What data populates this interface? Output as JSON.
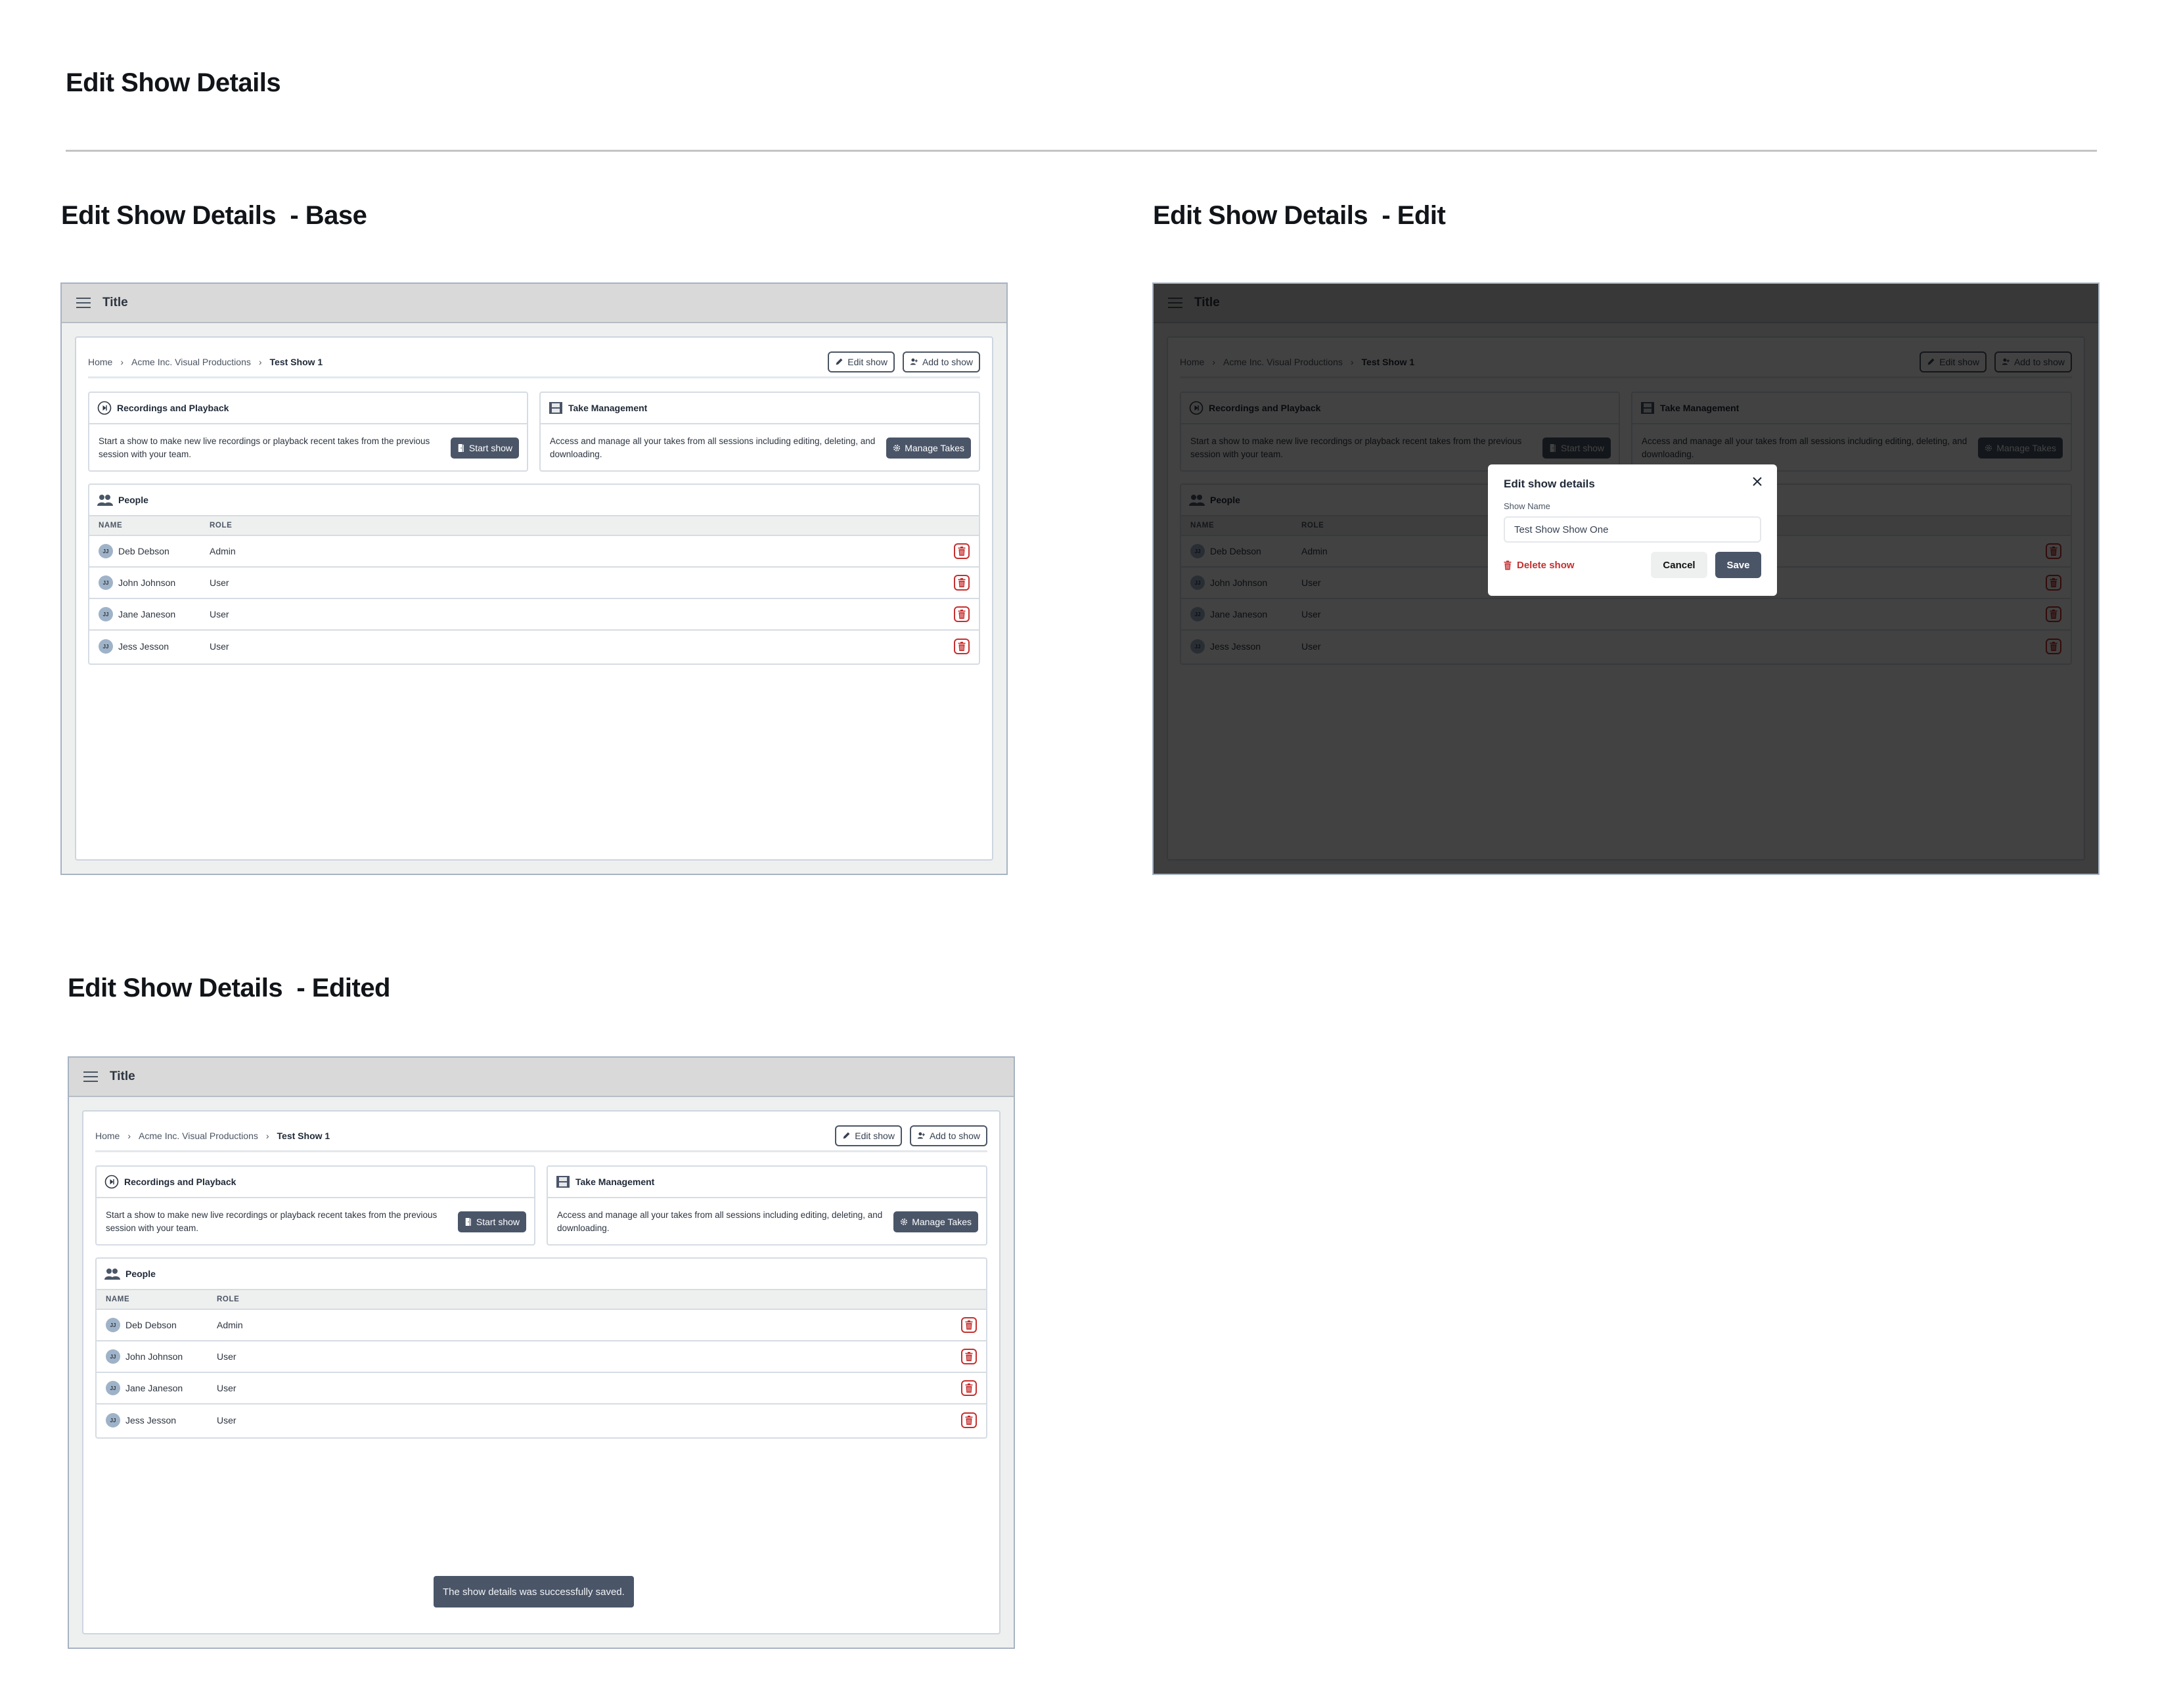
{
  "page": {
    "title": "Edit Show Details",
    "sections": {
      "base": "Edit Show Details  - Base",
      "edit": "Edit Show Details  - Edit",
      "edited": "Edit Show Details  - Edited"
    }
  },
  "app": {
    "topbar_title": "Title",
    "menu_icon": "hamburger-menu-icon",
    "breadcrumb": [
      "Home",
      "Acme Inc. Visual Productions",
      "Test Show 1"
    ],
    "breadcrumb_separator_icon": "chevron-right-icon",
    "actions": {
      "edit_show": "Edit show",
      "add_to_show": "Add to show"
    },
    "recordings": {
      "title": "Recordings and Playback",
      "icon": "play-circle-icon",
      "text": "Start a show to make new live recordings or playback recent takes from the previous session with your team.",
      "button": "Start show",
      "button_icon": "door-icon"
    },
    "takes": {
      "title": "Take Management",
      "icon": "film-icon",
      "text": "Access and manage all your takes from all sessions including editing, deleting, and downloading.",
      "button": "Manage Takes",
      "button_icon": "gear-icon"
    },
    "people": {
      "title": "People",
      "icon": "users-icon",
      "columns": [
        "NAME",
        "ROLE"
      ],
      "rows": [
        {
          "initials": "JJ",
          "name": "Deb Debson",
          "role": "Admin"
        },
        {
          "initials": "JJ",
          "name": "John Johnson",
          "role": "User"
        },
        {
          "initials": "JJ",
          "name": "Jane Janeson",
          "role": "User"
        },
        {
          "initials": "JJ",
          "name": "Jess Jesson",
          "role": "User"
        }
      ],
      "row_action_icon": "trash-icon"
    }
  },
  "modal": {
    "title": "Edit show details",
    "field_label": "Show Name",
    "field_value": "Test Show Show One",
    "delete_label": "Delete show",
    "cancel_label": "Cancel",
    "save_label": "Save"
  },
  "toast": {
    "message": "The show details was successfully saved."
  },
  "colors": {
    "primary_dark": "#4a5568",
    "danger": "#c53030",
    "topbar": "#d9d9d9",
    "frame_bg": "#eef0f0",
    "avatar": "#9fb3c8"
  }
}
